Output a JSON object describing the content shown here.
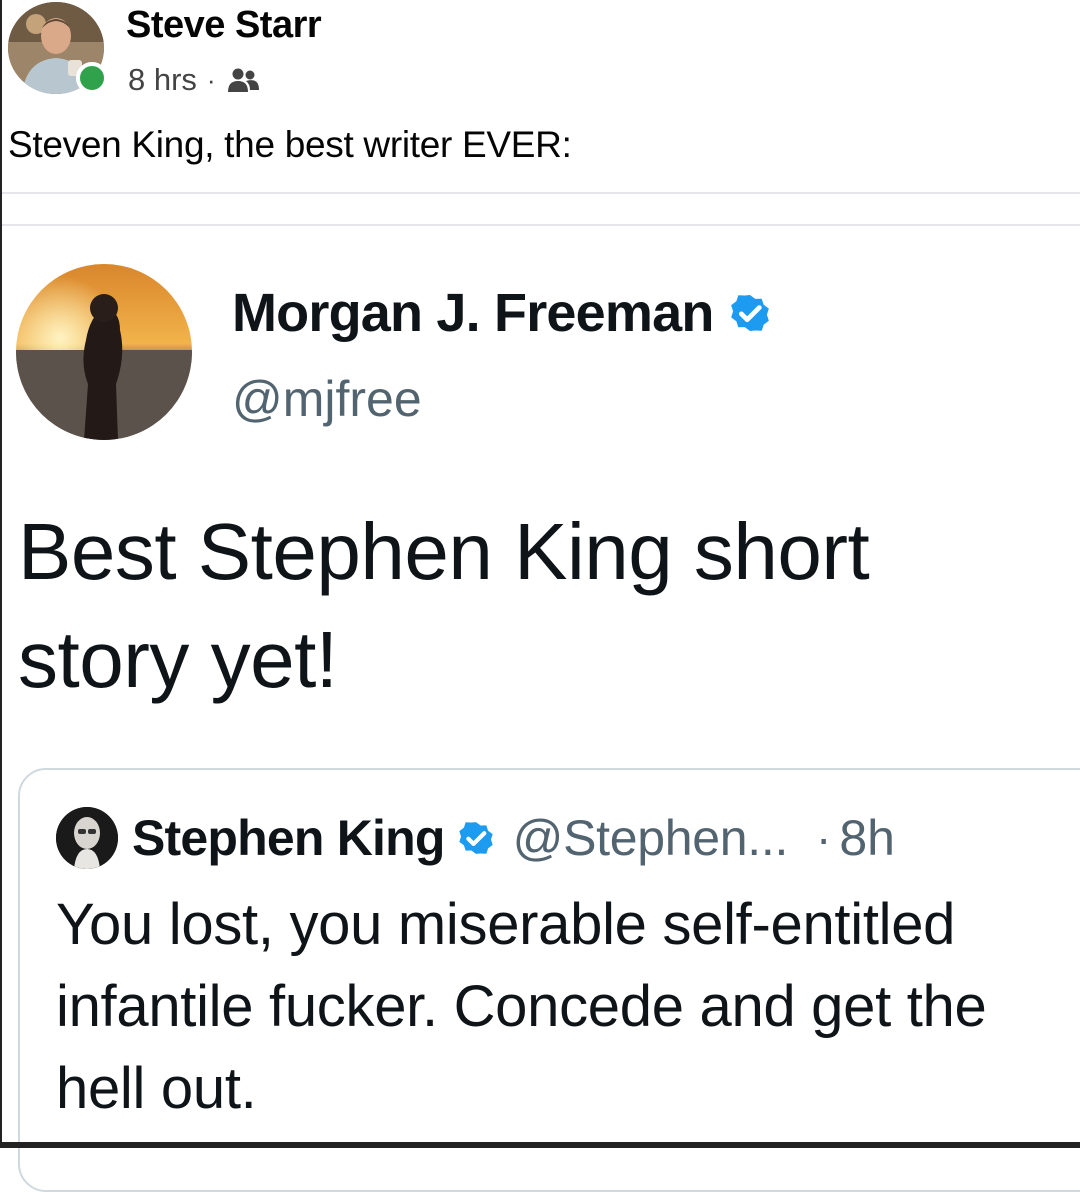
{
  "post": {
    "author": "Steve Starr",
    "time": "8 hrs",
    "separator": "·",
    "audience_icon": "friends-icon",
    "caption": "Steven King, the best writer EVER:"
  },
  "tweet": {
    "name": "Morgan J. Freeman",
    "handle": "@mjfree",
    "verified": true,
    "text": "Best Stephen King short story yet!"
  },
  "quote": {
    "name": "Stephen King",
    "verified": true,
    "handle": "@Stephen...",
    "separator": "·",
    "time": "8h",
    "text": "You lost, you miserable self-entitled infantile fucker. Concede and get the hell out."
  },
  "colors": {
    "online": "#31a24c",
    "verified": "#1d9bf0",
    "secondary_text": "#536471"
  }
}
